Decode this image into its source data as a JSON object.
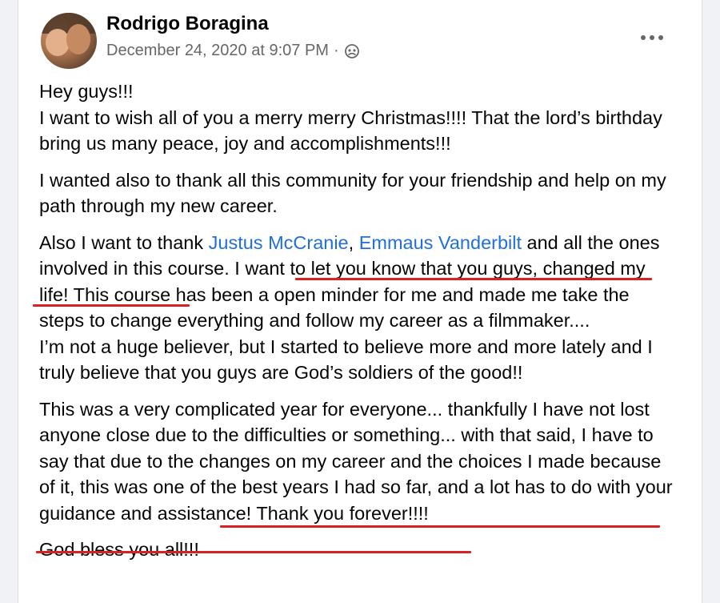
{
  "post": {
    "author": "Rodrigo Boragina",
    "timestamp": "December 24, 2020 at 9:07 PM",
    "separator": "·",
    "privacy_icon": "friends-globe-icon",
    "more_icon": "more-options-icon"
  },
  "content": {
    "p1_line1": "Hey guys!!!",
    "p1_line2": "I want to wish all of you a merry merry Christmas!!!! That the lord’s birthday bring us many peace, joy and accomplishments!!!",
    "p2": "I wanted also to thank all this community for your friendship and help on my path through my new career.",
    "p3_pre": "Also I want to thank ",
    "mention1": "Justus McCranie",
    "p3_comma": ", ",
    "mention2": "Emmaus Vanderbilt",
    "p3_rest": " and all the ones involved in this course. I want to let you know that you guys, changed my life! This course has been a open minder for me and made me take the steps to change everything and follow my career as a filmmaker....",
    "p3_line2": "I’m not a huge believer, but I started to believe more and more lately and I truly believe that you guys are God’s soldiers of the good!!",
    "p4": "This was a very complicated year for everyone... thankfully I have not lost anyone close due to the difficulties or something... with that said, I have to say that due to the changes on my career and the choices I made because of it, this was one of the best years I had so far, and a lot has to do with your guidance and assistance! Thank you forever!!!!",
    "p5": "God bless you all!!!"
  },
  "colors": {
    "link": "#216fdb",
    "underline": "#d92121",
    "meta": "#65676b"
  }
}
